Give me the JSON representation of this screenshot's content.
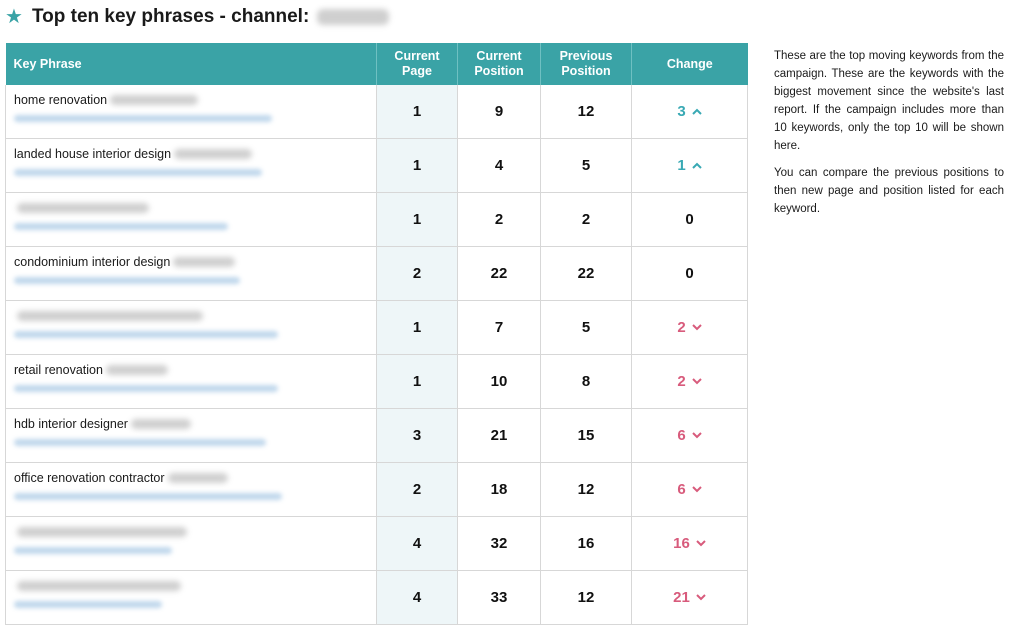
{
  "header": {
    "title": "Top ten key phrases - channel:",
    "star_icon": "star-icon"
  },
  "table": {
    "columns": [
      "Key Phrase",
      "Current Page",
      "Current Position",
      "Previous Position",
      "Change"
    ],
    "rows": [
      {
        "phrase": "home renovation",
        "current_page": "1",
        "current_position": "9",
        "previous_position": "12",
        "change": "3",
        "direction": "up"
      },
      {
        "phrase": "landed house interior design",
        "current_page": "1",
        "current_position": "4",
        "previous_position": "5",
        "change": "1",
        "direction": "up"
      },
      {
        "phrase": "",
        "current_page": "1",
        "current_position": "2",
        "previous_position": "2",
        "change": "0",
        "direction": "none"
      },
      {
        "phrase": "condominium interior design",
        "current_page": "2",
        "current_position": "22",
        "previous_position": "22",
        "change": "0",
        "direction": "none"
      },
      {
        "phrase": "",
        "current_page": "1",
        "current_position": "7",
        "previous_position": "5",
        "change": "2",
        "direction": "down"
      },
      {
        "phrase": "retail renovation",
        "current_page": "1",
        "current_position": "10",
        "previous_position": "8",
        "change": "2",
        "direction": "down"
      },
      {
        "phrase": "hdb interior designer",
        "current_page": "3",
        "current_position": "21",
        "previous_position": "15",
        "change": "6",
        "direction": "down"
      },
      {
        "phrase": "office renovation contractor",
        "current_page": "2",
        "current_position": "18",
        "previous_position": "12",
        "change": "6",
        "direction": "down"
      },
      {
        "phrase": "",
        "current_page": "4",
        "current_position": "32",
        "previous_position": "16",
        "change": "16",
        "direction": "down"
      },
      {
        "phrase": "",
        "current_page": "4",
        "current_position": "33",
        "previous_position": "12",
        "change": "21",
        "direction": "down"
      }
    ]
  },
  "notes": {
    "paragraph1": "These are the top moving keywords from the campaign. These are the keywords with the biggest movement since the website's last report. If the campaign includes more than 10 keywords, only the top 10 will be shown here.",
    "paragraph2": "You can compare the previous positions to then new page and position listed for each keyword."
  },
  "colors": {
    "accent": "#3aa3a6",
    "up": "#39a9b4",
    "down": "#d85b7c"
  }
}
